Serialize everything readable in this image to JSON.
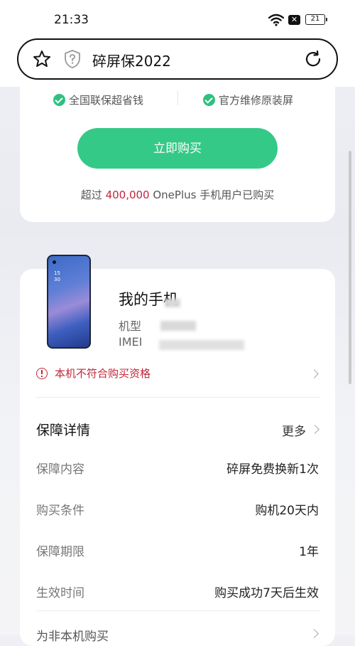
{
  "status_bar": {
    "time": "21:33",
    "battery": "21",
    "x_badge": "✕"
  },
  "browser": {
    "url_text": "碎屏保2022"
  },
  "promo": {
    "feature_1": "全国联保超省钱",
    "feature_2": "官方维修原装屏",
    "buy_button": "立即购买",
    "users_prefix": "超过 ",
    "users_count": "400,000",
    "users_suffix": " OnePlus 手机用户已购买"
  },
  "device": {
    "screen_clock_1": "15",
    "screen_clock_2": "30",
    "title": "我的手机",
    "model_label": "机型",
    "imei_label": "IMEI",
    "warning": "本机不符合购买资格"
  },
  "guarantee": {
    "title": "保障详情",
    "more": "更多",
    "rows": [
      {
        "label": "保障内容",
        "value": "碎屏免费换新1次"
      },
      {
        "label": "购买条件",
        "value": "购机20天内"
      },
      {
        "label": "保障期限",
        "value": "1年"
      },
      {
        "label": "生效时间",
        "value": "购买成功7天后生效"
      }
    ],
    "next_row_partial": "为非本机购买"
  },
  "colors": {
    "accent_green": "#35c987",
    "warning_red": "#c0283a"
  }
}
